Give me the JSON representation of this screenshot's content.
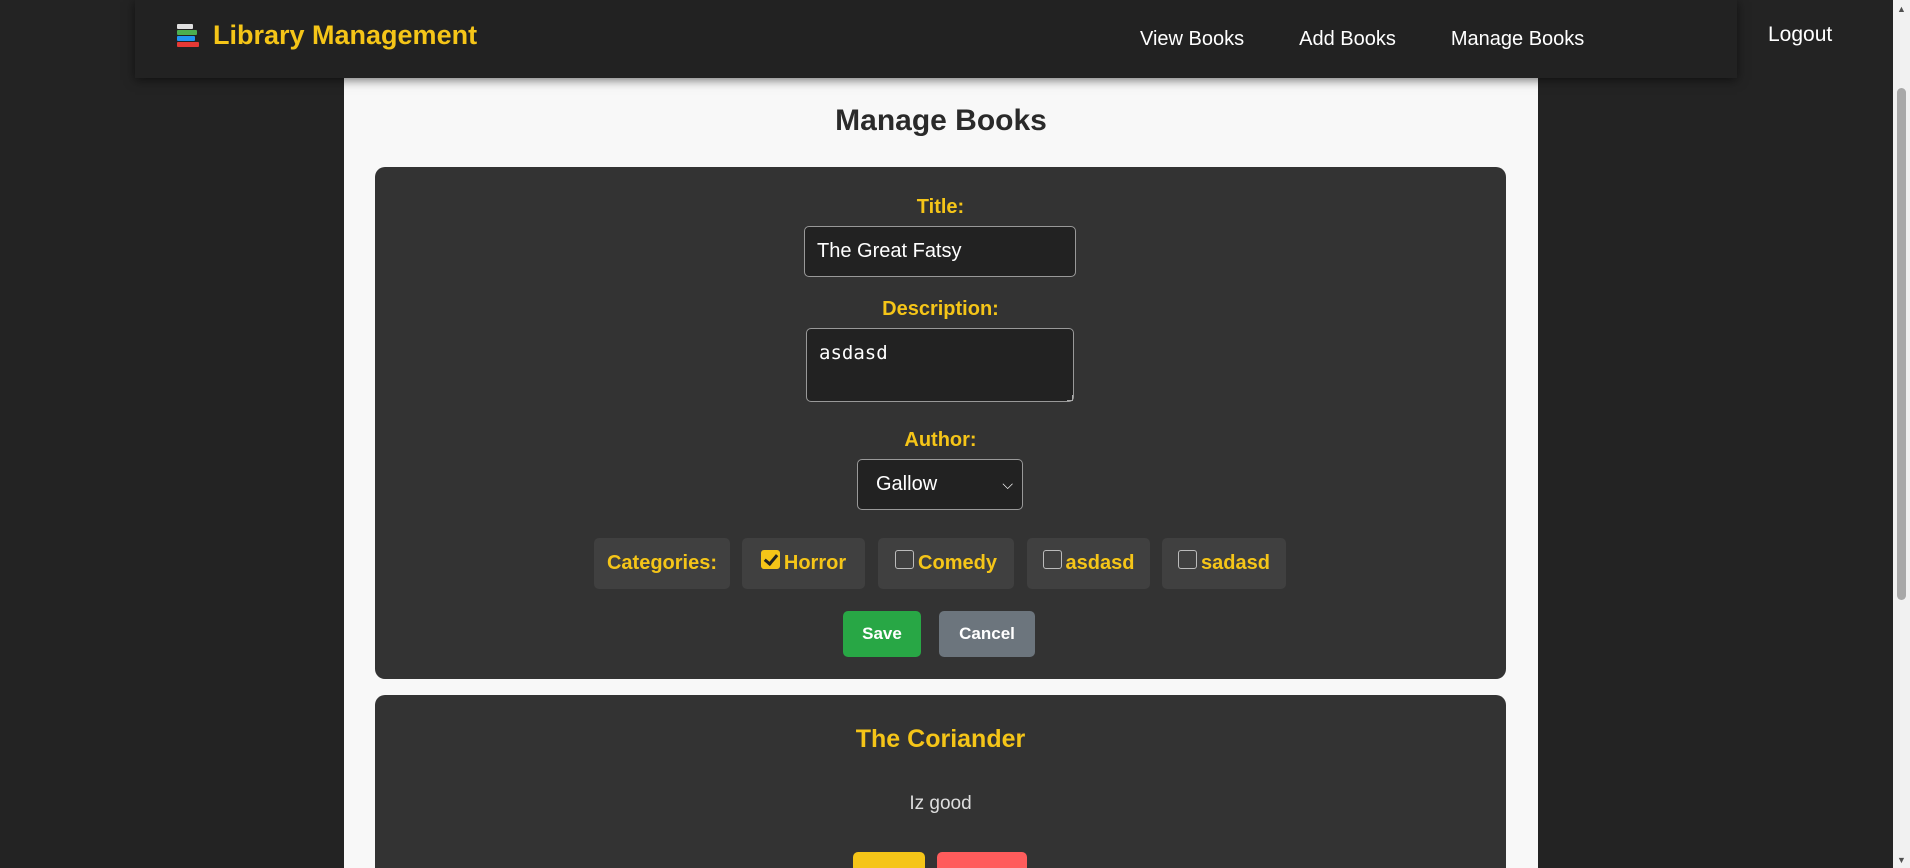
{
  "navbar": {
    "brand": "Library Management",
    "links": [
      "View Books",
      "Add Books",
      "Manage Books"
    ],
    "logout": "Logout"
  },
  "page": {
    "title": "Manage Books"
  },
  "edit_form": {
    "title_label": "Title:",
    "title_value": "The Great Fatsy",
    "description_label": "Description:",
    "description_value": "asdasd",
    "author_label": "Author:",
    "author_selected": "Gallow",
    "categories_label": "Categories:",
    "categories": [
      {
        "label": "Horror",
        "checked": true
      },
      {
        "label": "Comedy",
        "checked": false
      },
      {
        "label": "asdasd",
        "checked": false
      },
      {
        "label": "sadasd",
        "checked": false
      }
    ],
    "save_label": "Save",
    "cancel_label": "Cancel"
  },
  "book_cards": [
    {
      "title": "The Coriander",
      "description": "Iz good"
    }
  ],
  "colors": {
    "accent": "#f5c518",
    "save": "#28a745",
    "cancel": "#6c757d",
    "delete": "#ff5c5c",
    "card": "#333333",
    "background": "#232323"
  }
}
